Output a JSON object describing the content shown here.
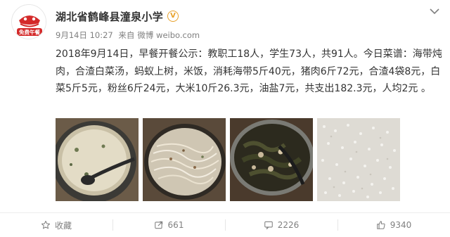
{
  "post": {
    "author": "湖北省鹤峰县潼泉小学",
    "verified_icon": "verified-badge-icon",
    "date": "9月14日 10:27",
    "source_prefix": "来自",
    "source": "微博 weibo.com",
    "text": "2018年9月14日，早餐开餐公示：教职工18人，学生73人，共91人。今日菜谱：海带炖肉，合渣白菜汤，蚂蚁上树，米饭，消耗海带5斤40元，猪肉6斤72元，合渣4袋8元，白菜5斤5元，粉丝6斤24元，大米10斤26.3元，油盐7元，共支出182.3元，人均2元 。"
  },
  "avatar": {
    "badge_text": "免费午餐",
    "accent_color": "#d42a2a"
  },
  "photos": [
    {
      "name": "photo-cabbage-soup"
    },
    {
      "name": "photo-vermicelli"
    },
    {
      "name": "photo-kelp-pork"
    },
    {
      "name": "photo-rice"
    }
  ],
  "actions": {
    "favorite": {
      "label": "收藏",
      "icon": "star-icon"
    },
    "repost": {
      "label": "661",
      "icon": "repost-icon"
    },
    "comment": {
      "label": "2226",
      "icon": "comment-icon"
    },
    "like": {
      "label": "9340",
      "icon": "thumbs-up-icon"
    }
  }
}
